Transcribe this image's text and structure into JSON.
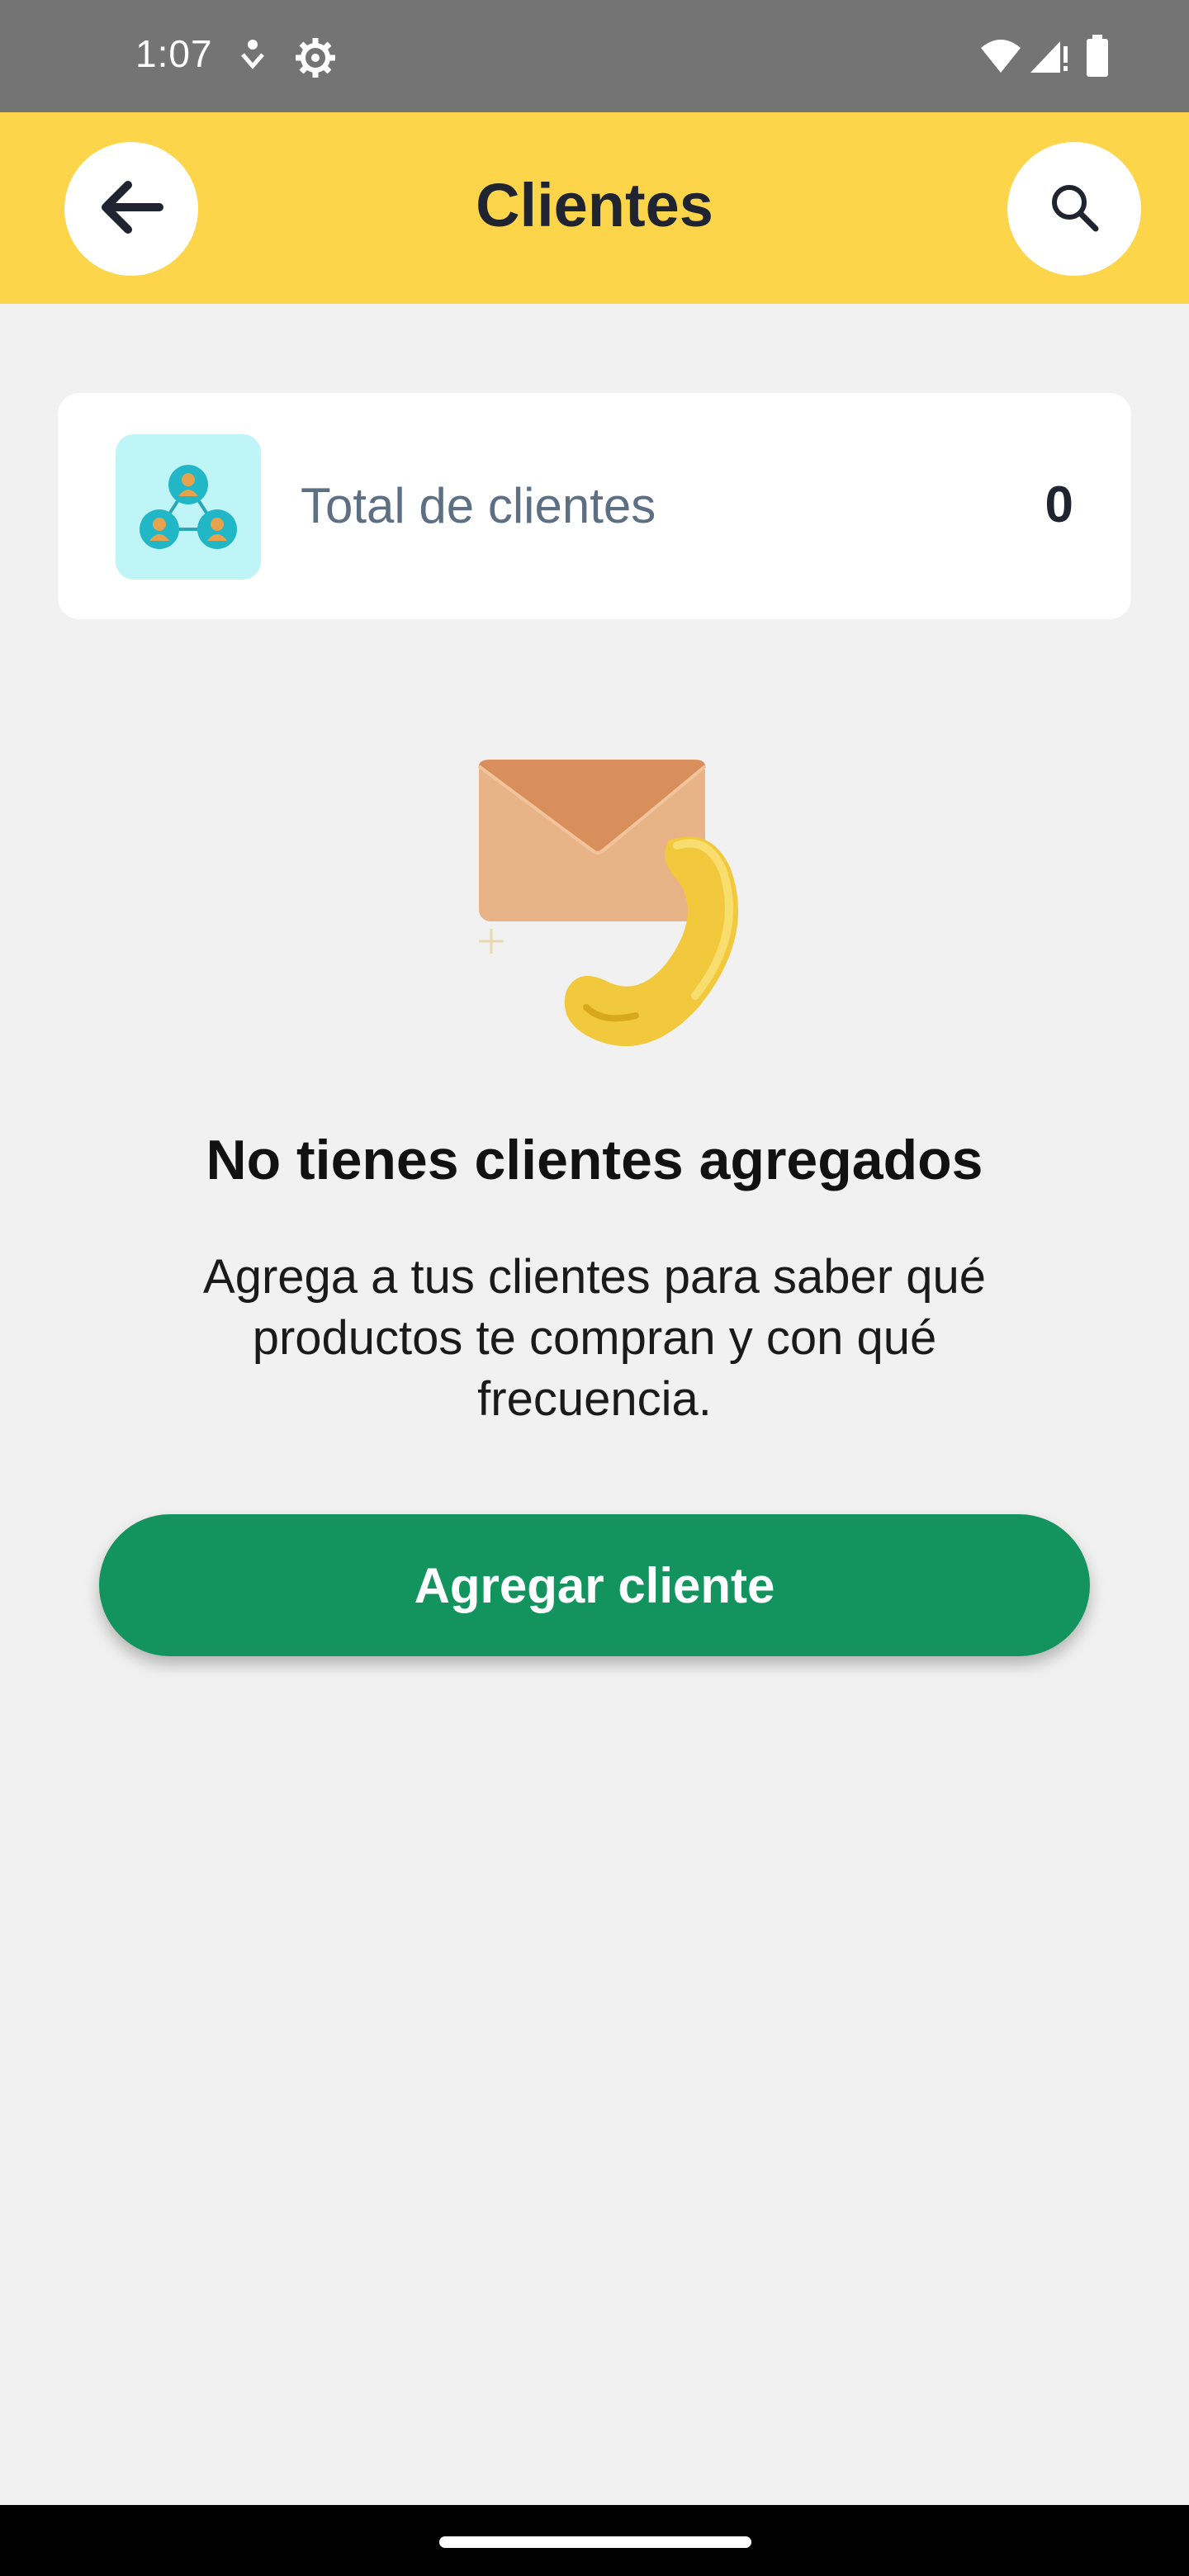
{
  "status_bar": {
    "time": "1:07",
    "icons": [
      "accessibility-icon",
      "settings-gear-icon",
      "wifi-icon",
      "signal-icon",
      "battery-icon"
    ]
  },
  "app_bar": {
    "title": "Clientes",
    "back_icon": "arrow-left-icon",
    "search_icon": "search-icon",
    "color": "#fdd54a"
  },
  "summary": {
    "label": "Total de clientes",
    "value": "0",
    "icon": "customers-network-icon"
  },
  "empty_state": {
    "illustration": "envelope-phone-illustration",
    "title": "No tienes clientes agregados",
    "description": "Agrega a tus clientes para saber qué productos te compran y con qué frecuencia."
  },
  "actions": {
    "add_label": "Agregar cliente",
    "add_color": "#13945f"
  }
}
